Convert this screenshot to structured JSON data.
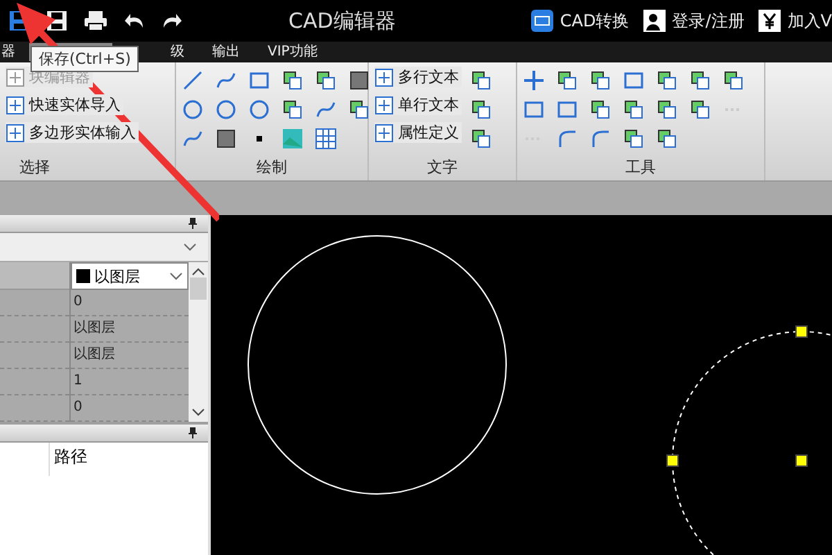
{
  "window": {
    "title": "CAD编辑器"
  },
  "quick_access": {
    "tooltip": "保存(Ctrl+S)"
  },
  "header_links": [
    {
      "label": "CAD转换"
    },
    {
      "label": "登录/注册"
    },
    {
      "label": "加入V"
    }
  ],
  "tabs": [
    {
      "label": "器",
      "selected": false
    },
    {
      "selected": true
    },
    {
      "label": "级",
      "selected": false
    },
    {
      "label": "输出",
      "selected": false
    },
    {
      "label": "VIP功能",
      "selected": false
    }
  ],
  "ribbon": {
    "groups": [
      {
        "title": "选择",
        "items": [
          {
            "label": "块编辑器",
            "disabled": true
          },
          {
            "label": "快速实体导入",
            "disabled": false
          },
          {
            "label": "多边形实体输入",
            "disabled": false
          }
        ]
      },
      {
        "title": "绘制"
      },
      {
        "title": "文字",
        "items": [
          {
            "label": "多行文本",
            "disabled": false
          },
          {
            "label": "单行文本",
            "disabled": false
          },
          {
            "label": "属性定义",
            "disabled": false
          }
        ]
      },
      {
        "title": "工具"
      }
    ]
  },
  "properties": {
    "color_value": "以图层",
    "values": [
      "0",
      "以图层",
      "以图层",
      "1",
      "0"
    ]
  },
  "files_panel": {
    "columns": [
      "路径"
    ]
  }
}
